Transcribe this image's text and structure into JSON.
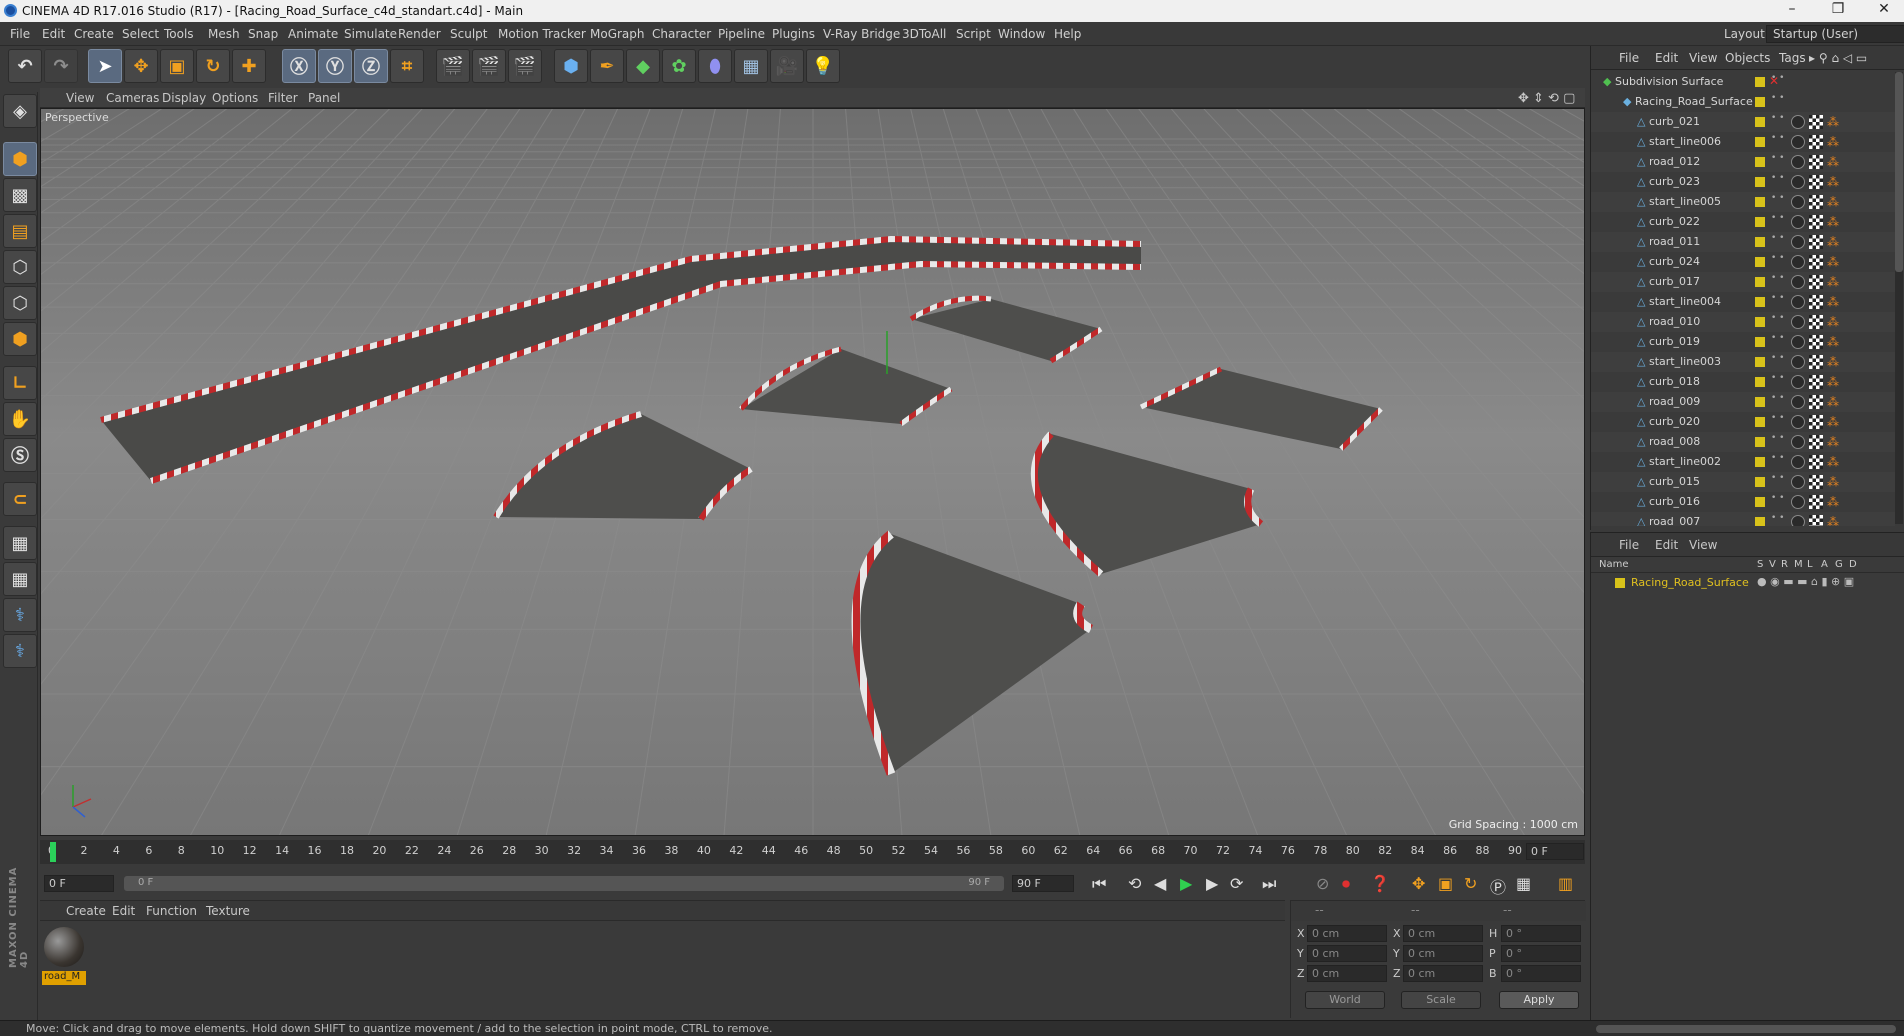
{
  "window": {
    "title": "CINEMA 4D R17.016 Studio (R17) - [Racing_Road_Surface_c4d_standart.c4d] - Main"
  },
  "menubar": {
    "items": [
      "File",
      "Edit",
      "Create",
      "Select",
      "Tools",
      "Mesh",
      "Snap",
      "Animate",
      "Simulate",
      "Render",
      "Sculpt",
      "Motion Tracker",
      "MoGraph",
      "Character",
      "Pipeline",
      "Plugins",
      "V-Ray Bridge",
      "3DToAll",
      "Script",
      "Window",
      "Help"
    ],
    "layout_label": "Layout:",
    "layout_value": "Startup (User)"
  },
  "viewport": {
    "menu": [
      "View",
      "Cameras",
      "Display",
      "Options",
      "Filter",
      "Panel"
    ],
    "label": "Perspective",
    "grid_spacing": "Grid Spacing : 1000 cm"
  },
  "timeline": {
    "ticks": [
      "0",
      "2",
      "4",
      "6",
      "8",
      "10",
      "12",
      "14",
      "16",
      "18",
      "20",
      "22",
      "24",
      "26",
      "28",
      "30",
      "32",
      "34",
      "36",
      "38",
      "40",
      "42",
      "44",
      "46",
      "48",
      "50",
      "52",
      "54",
      "56",
      "58",
      "60",
      "62",
      "64",
      "66",
      "68",
      "70",
      "72",
      "74",
      "76",
      "78",
      "80",
      "82",
      "84",
      "86",
      "88",
      "90"
    ],
    "current_frame": "0 F",
    "start": "0 F",
    "range_start": "0 F",
    "range_end": "90 F",
    "end": "90 F",
    "playhead_fraction": 0.0
  },
  "material_panel": {
    "menu": [
      "Create",
      "Edit",
      "Function",
      "Texture"
    ],
    "material_name": "road_M"
  },
  "coords": {
    "header": [
      "--",
      "--",
      "--"
    ],
    "x": "0 cm",
    "y": "0 cm",
    "z": "0 cm",
    "sx": "0 cm",
    "sy": "0 cm",
    "sz": "0 cm",
    "h": "0 °",
    "p": "0 °",
    "b": "0 °",
    "world": "World",
    "scale": "Scale",
    "apply": "Apply",
    "labels": [
      "X",
      "Y",
      "Z",
      "X",
      "Y",
      "Z",
      "H",
      "P",
      "B"
    ]
  },
  "object_manager": {
    "menu": [
      "File",
      "Edit",
      "View",
      "Objects",
      "Tags"
    ],
    "root": "Subdivision Surface",
    "group": "Racing_Road_Surface",
    "objects": [
      "curb_021",
      "start_line006",
      "road_012",
      "curb_023",
      "start_line005",
      "curb_022",
      "road_011",
      "curb_024",
      "curb_017",
      "start_line004",
      "road_010",
      "curb_019",
      "start_line003",
      "curb_018",
      "road_009",
      "curb_020",
      "road_008",
      "start_line002",
      "curb_015",
      "curb_016",
      "road_007"
    ]
  },
  "attribute_manager": {
    "menu": [
      "File",
      "Edit",
      "View"
    ],
    "columns": [
      "Name",
      "S",
      "V",
      "R",
      "M",
      "L",
      "A",
      "G",
      "D"
    ],
    "row_name": "Racing_Road_Surface"
  },
  "brand": "MAXON CINEMA 4D",
  "statusbar": {
    "text": "Move: Click and drag to move elements. Hold down SHIFT to quantize movement / add to the selection in point mode, CTRL to remove."
  },
  "colors": {
    "accent_yellow": "#d8c21a",
    "curb_red": "#c0282a",
    "material_selected": "#e0a000"
  }
}
